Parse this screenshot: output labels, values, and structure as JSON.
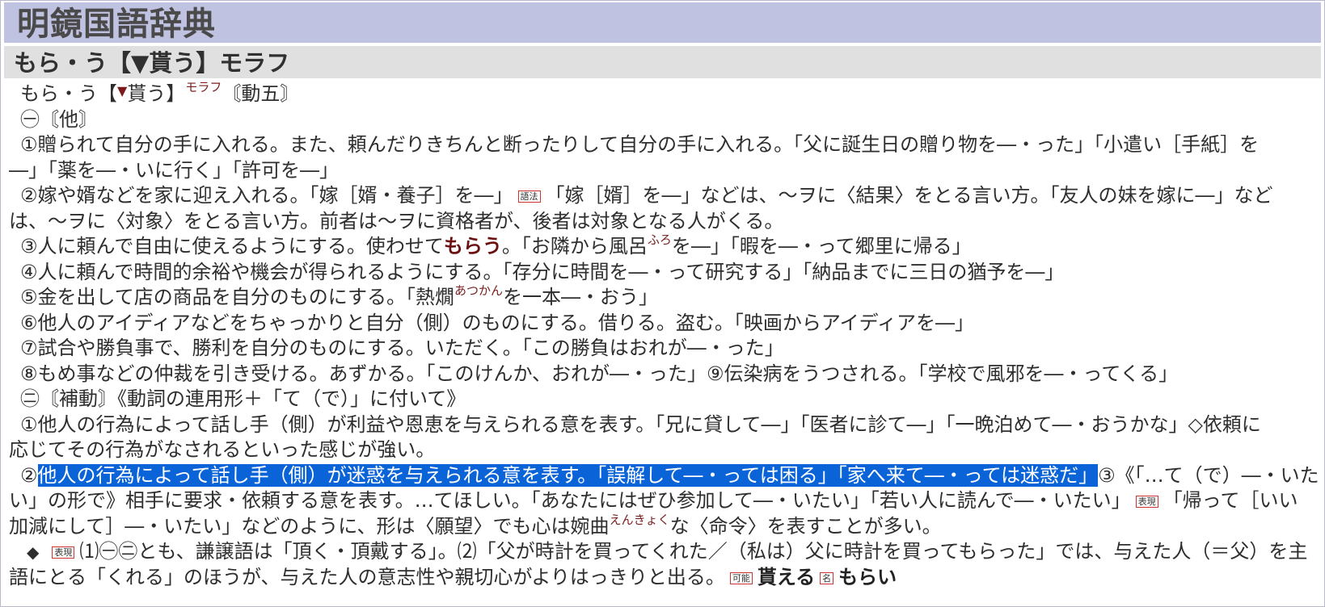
{
  "window": {
    "dict_title": "明鏡国語辞典",
    "headword_bar": "もら・う【▼貰う】モラフ"
  },
  "entry": {
    "hw": "もら・う",
    "bracket_open": "【",
    "tri": "▼",
    "kanji": "貰う】",
    "kana_ruby": "モラフ",
    "pos": "〘動五〙",
    "sec1": "㊀〘他〙",
    "d1a": "①贈られて自分の手に入れる。また、頼んだりきちんと断ったりして自分の手に入れる。「父に誕生日の贈り物を―・った」「小遣い［手紙］を",
    "d1b": "―」「薬を―・いに行く」「許可を―」",
    "d2a_pre": "②嫁や婿などを家に迎え入れる。「嫁［婿・養子］を―」",
    "tag_gohou": "語法",
    "d2a_post": "「嫁［婿］を―」などは、〜ヲに〈結果〉をとる言い方。「友人の妹を嫁に―」など",
    "d2b": "は、〜ヲに〈対象〉をとる言い方。前者は〜ヲに資格者が、後者は対象となる人がくる。",
    "d3_pre": "③人に頼んで自由に使えるようにする。使わせて",
    "d3_em": "もらう",
    "d3_mid": "。「お隣から風呂",
    "d3_ruby": "ふろ",
    "d3_post": "を―」「暇を―・って郷里に帰る」",
    "d4": "④人に頼んで時間的余裕や機会が得られるようにする。「存分に時間を―・って研究する」「納品までに三日の猶予を―」",
    "d5_pre": "⑤金を出して店の商品を自分のものにする。「熱燗",
    "d5_ruby": "あつかん",
    "d5_post": "を一本―・おう」",
    "d6": "⑥他人のアイディアなどをちゃっかりと自分（側）のものにする。借りる。盗む。「映画からアイディアを―」",
    "d7": "⑦試合や勝負事で、勝利を自分のものにする。いただく。「この勝負はおれが―・った」",
    "d8": "⑧もめ事などの仲裁を引き受ける。あずかる。「このけんか、おれが―・った」⑨伝染病をうつされる。「学校で風邪を―・ってくる」",
    "sec2": "㊁〘補動〙《動詞の連用形＋「て（で）」に付いて》",
    "e1a": "①他人の行為によって話し手（側）が利益や恩恵を与えられる意を表す。「兄に貸して―」「医者に診て―」「一晩泊めて―・おうかな」◇依頼に",
    "e1b": "応じてその行為がなされるといった感じが強い。",
    "e2_num": "②",
    "e2_hl": "他人の行為によって話し手（側）が迷惑を与えられる意を表す。「誤解して―・っては困る」「家へ来て―・っては迷惑だ」",
    "e3a": "③《「…て（で）―・いた",
    "e3b_pre": "い」の形で》相手に要求・依頼する意を表す。…てほしい。「あなたにはぜひ参加して―・いたい」「若い人に読んで―・いたい」",
    "tag_hyogen1": "表現",
    "e3b_post": "「帰って［いい",
    "e3c_pre": "加減にして］―・いたい」などのように、形は〈願望〉でも心は婉曲",
    "e3c_ruby": "えんきょく",
    "e3c_post": "な〈命令〉を表すことが多い。",
    "f_diamond": "◆",
    "tag_hyogen2": "表現",
    "f1_text": "⑴㊀㊁とも、謙譲語は「頂く・頂戴する」。⑵「父が時計を買ってくれた／（私は）父に時計を買ってもらった」では、与えた人（＝父）を主",
    "f2_text": "語にとる「くれる」のほうが、与えた人の意志性や親切心がよりはっきりと出る。",
    "tag_kanou": "可能",
    "kanou_word": "貰える",
    "tag_mei": "名",
    "mei_word": "もらい"
  }
}
